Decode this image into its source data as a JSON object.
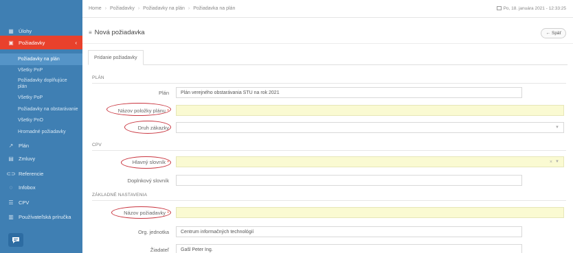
{
  "sidebar": {
    "items": [
      {
        "label": "Úlohy",
        "icon": "calendar-icon"
      },
      {
        "label": "Požiadavky",
        "icon": "cart-icon"
      },
      {
        "label": "Plán",
        "icon": "chart-icon"
      },
      {
        "label": "Zmluvy",
        "icon": "document-icon"
      },
      {
        "label": "Referencie",
        "icon": "link-icon"
      },
      {
        "label": "Infobox",
        "icon": "info-icon"
      },
      {
        "label": "CPV",
        "icon": "list-icon"
      },
      {
        "label": "Používateľská príručka",
        "icon": "book-icon"
      }
    ],
    "subitems": [
      {
        "label": "Požiadavky na plán"
      },
      {
        "label": "Všetky PnP"
      },
      {
        "label": "Požiadavky doplňujúce plán"
      },
      {
        "label": "Všetky PoP"
      },
      {
        "label": "Požiadavky na obstarávanie"
      },
      {
        "label": "Všetky PnO"
      },
      {
        "label": "Hromadné požiadavky"
      }
    ]
  },
  "header": {
    "breadcrumb": [
      "Home",
      "Požiadavky",
      "Požiadavky na plán",
      "Požiadavka na plán"
    ],
    "datetime": "Po, 18. januára 2021 - 12:33:25"
  },
  "page": {
    "title": "Nová požiadavka",
    "back_label": "Späť",
    "tab_label": "Pridanie požiadavky"
  },
  "form": {
    "section_plan": "PLÁN",
    "section_cpv": "CPV",
    "section_settings": "ZÁKLADNÉ NASTAVENIA",
    "plan_label": "Plán",
    "plan_value": "Plán verejného obstarávania STU na rok 2021",
    "item_name_label": "Názov položky plánu",
    "item_name_value": "",
    "order_type_label": "Druh zákazky",
    "order_type_value": "",
    "main_dict_label": "Hlavný slovník",
    "main_dict_value": "",
    "extra_dict_label": "Doplnkový slovník",
    "extra_dict_value": "",
    "request_name_label": "Názov požiadavky",
    "request_name_value": "",
    "org_unit_label": "Org. jednotka",
    "org_unit_value": "Centrum informačných technológií",
    "applicant_label": "Žiadateľ",
    "applicant_value": "Gašl Peter Ing."
  },
  "colors": {
    "sidebar": "#3f7fb3",
    "active": "#e8412c",
    "selected_sub": "#5594c7",
    "required_field": "#fafad2",
    "annotation": "#c8323c"
  }
}
